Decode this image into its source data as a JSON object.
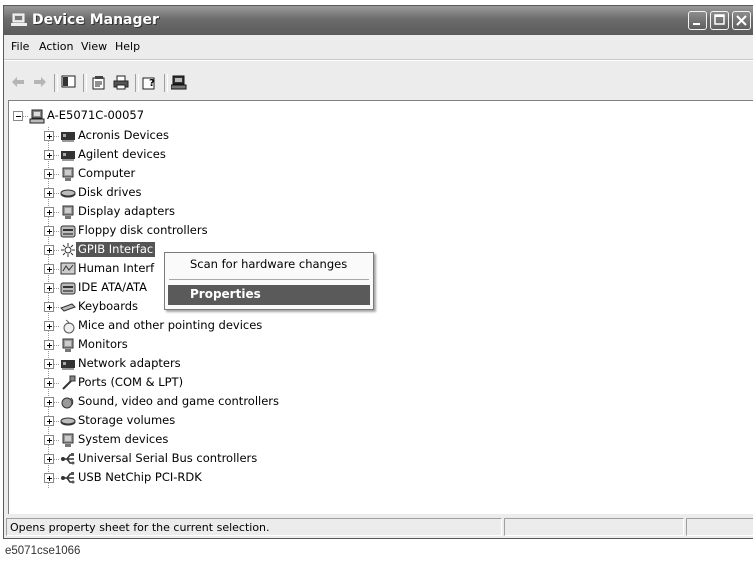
{
  "window": {
    "title": "Device Manager"
  },
  "menu": [
    "File",
    "Action",
    "View",
    "Help"
  ],
  "toolbar_icons": [
    "back-icon",
    "forward-icon",
    "console-tree-icon",
    "properties-icon",
    "print-icon",
    "help-icon",
    "scan-hardware-icon"
  ],
  "tree": {
    "root": {
      "label": "A-E5071C-00057",
      "icon": "computer-icon"
    },
    "items": [
      {
        "label": "Acronis Devices",
        "icon": "card-icon"
      },
      {
        "label": "Agilent devices",
        "icon": "card-icon"
      },
      {
        "label": "Computer",
        "icon": "computer-monitor-icon"
      },
      {
        "label": "Disk drives",
        "icon": "disk-drive-icon"
      },
      {
        "label": "Display adapters",
        "icon": "monitor-icon"
      },
      {
        "label": "Floppy disk controllers",
        "icon": "floppy-controller-icon"
      },
      {
        "label": "GPIB Interfac",
        "icon": "gpib-icon",
        "selected": true
      },
      {
        "label": "Human Interf",
        "icon": "hid-icon"
      },
      {
        "label": "IDE ATA/ATA",
        "icon": "ide-icon"
      },
      {
        "label": "Keyboards",
        "icon": "keyboard-icon"
      },
      {
        "label": "Mice and other pointing devices",
        "icon": "mouse-icon"
      },
      {
        "label": "Monitors",
        "icon": "monitor-icon"
      },
      {
        "label": "Network adapters",
        "icon": "card-icon"
      },
      {
        "label": "Ports (COM & LPT)",
        "icon": "port-icon"
      },
      {
        "label": "Sound, video and game controllers",
        "icon": "sound-icon"
      },
      {
        "label": "Storage volumes",
        "icon": "disk-drive-icon"
      },
      {
        "label": "System devices",
        "icon": "computer-monitor-icon"
      },
      {
        "label": "Universal Serial Bus controllers",
        "icon": "usb-icon"
      },
      {
        "label": "USB NetChip PCI-RDK",
        "icon": "usb-icon"
      }
    ]
  },
  "context_menu": {
    "items": [
      "Scan for hardware changes",
      "Properties"
    ],
    "highlighted": "Properties"
  },
  "status_bar": {
    "text": "Opens property sheet for the current selection."
  },
  "caption": "e5071cse1066"
}
